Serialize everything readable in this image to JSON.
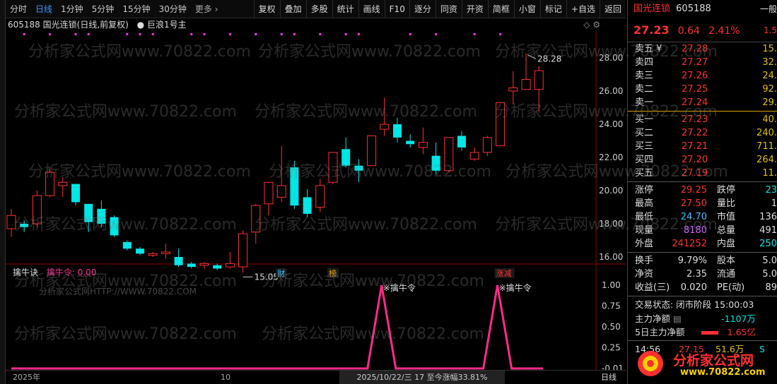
{
  "toolbar": {
    "periods": [
      "分时",
      "日线",
      "1分钟",
      "5分钟",
      "15分钟",
      "30分钟",
      "更多 ›"
    ],
    "active_period_index": 1,
    "tools": [
      "复权",
      "叠加",
      "多股",
      "统计",
      "画线",
      "F10",
      "逐分",
      "同资",
      "开资",
      "简框",
      "小窗",
      "标记",
      "+自选",
      "返回"
    ]
  },
  "chart": {
    "header_code": "605188",
    "header_name": "国光连锁",
    "header_mode": "(日线,前复权)",
    "indicator_name": "巨浪1号主",
    "y_labels": [
      "28.00",
      "26.00",
      "24.00",
      "22.00",
      "20.00",
      "18.00",
      "16.00"
    ],
    "max_label": "28.28",
    "min_label": "15.05",
    "event_marks": [
      "财",
      "榜",
      "涨减"
    ],
    "up_color": "#ff3030",
    "down_color": "#00e5e5",
    "candles": [
      [
        17.7,
        18.5,
        17.2,
        18.9
      ],
      [
        18.0,
        17.8,
        17.5,
        18.2
      ],
      [
        18.0,
        19.7,
        17.8,
        20.0
      ],
      [
        19.7,
        21.1,
        19.6,
        21.4
      ],
      [
        20.3,
        20.5,
        19.6,
        20.8
      ],
      [
        20.4,
        19.3,
        19.1,
        20.4
      ],
      [
        19.2,
        18.1,
        17.5,
        19.2
      ],
      [
        18.9,
        18.0,
        17.8,
        19.4
      ],
      [
        18.4,
        17.3,
        17.2,
        18.5
      ],
      [
        16.9,
        16.5,
        16.4,
        17.0
      ],
      [
        16.5,
        16.2,
        16.1,
        16.6
      ],
      [
        16.1,
        16.2,
        16.0,
        16.3
      ],
      [
        16.2,
        16.3,
        15.9,
        16.8
      ],
      [
        16.0,
        15.5,
        15.4,
        16.5
      ],
      [
        15.6,
        15.4,
        15.3,
        15.7
      ],
      [
        15.5,
        15.6,
        15.3,
        15.7
      ],
      [
        15.5,
        15.3,
        15.2,
        15.6
      ],
      [
        15.4,
        15.6,
        15.3,
        16.3
      ],
      [
        15.4,
        17.4,
        15.05,
        17.6
      ],
      [
        17.5,
        19.1,
        16.8,
        19.2
      ],
      [
        19.2,
        20.5,
        18.5,
        20.5
      ],
      [
        19.6,
        20.3,
        19.3,
        22.7
      ],
      [
        21.4,
        19.1,
        18.9,
        21.8
      ],
      [
        19.6,
        18.6,
        18.4,
        20.1
      ],
      [
        19.0,
        20.3,
        18.7,
        20.7
      ],
      [
        20.5,
        22.3,
        20.4,
        22.3
      ],
      [
        22.5,
        21.5,
        21.4,
        23.2
      ],
      [
        21.5,
        21.2,
        20.5,
        21.9
      ],
      [
        21.5,
        23.3,
        21.5,
        23.3
      ],
      [
        23.7,
        24.0,
        23.3,
        25.6
      ],
      [
        24.0,
        23.2,
        22.9,
        24.4
      ],
      [
        23.0,
        22.8,
        22.6,
        23.4
      ],
      [
        22.6,
        22.9,
        22.2,
        23.8
      ],
      [
        22.1,
        21.2,
        21.0,
        22.9
      ],
      [
        21.2,
        23.2,
        21.1,
        23.2
      ],
      [
        23.3,
        22.6,
        22.4,
        23.6
      ],
      [
        21.9,
        22.3,
        21.8,
        22.6
      ],
      [
        22.3,
        23.2,
        22.1,
        23.3
      ],
      [
        22.7,
        25.3,
        22.7,
        25.3
      ],
      [
        26.0,
        26.2,
        25.2,
        27.2
      ],
      [
        26.1,
        26.7,
        26.1,
        28.28
      ],
      [
        26.1,
        27.23,
        24.7,
        27.5
      ]
    ],
    "marker_dot_color": "#ff33ff"
  },
  "sub": {
    "name": "擒牛诀",
    "value_label": "擒牛令: 0.00",
    "watermark_line": "分析家公式网HTTP://WWW.70822.COM",
    "y_labels": [
      "1.00",
      "0.75",
      "0.50",
      "0.25",
      "-0.01"
    ],
    "signal_label": "※擒牛令",
    "line_color": "#ff2a8a"
  },
  "footer": {
    "year": "2025年",
    "month": "10",
    "range": "2025/10/22/三  17  至今涨幅33.81%",
    "period": "日线"
  },
  "panel": {
    "name": "国光连锁",
    "code": "605188",
    "tag": "一般",
    "price": "27.23",
    "change": "0.64",
    "pct": "2.41%",
    "tag2": "1.5",
    "asks": [
      {
        "label": "卖五 ¥",
        "price": "27.28",
        "vol": "15."
      },
      {
        "label": "卖四",
        "price": "27.27",
        "vol": "32."
      },
      {
        "label": "卖三",
        "price": "27.26",
        "vol": "24."
      },
      {
        "label": "卖二",
        "price": "27.25",
        "vol": "92."
      },
      {
        "label": "卖一",
        "price": "27.24",
        "vol": "29."
      }
    ],
    "bids": [
      {
        "label": "买一",
        "price": "27.23",
        "vol": "40."
      },
      {
        "label": "买二",
        "price": "27.22",
        "vol": "240."
      },
      {
        "label": "买三",
        "price": "27.21",
        "vol": "711."
      },
      {
        "label": "买四",
        "price": "27.20",
        "vol": "264."
      },
      {
        "label": "买五",
        "price": "27.19",
        "vol": "11."
      }
    ],
    "quote1": [
      {
        "l1": "涨停",
        "v1": "29.25",
        "c1": "#ff3030",
        "l2": "跌停",
        "v2": "23",
        "c2": "#00e5e5"
      },
      {
        "l1": "最高",
        "v1": "27.50",
        "c1": "#ff3030",
        "l2": "量比",
        "v2": "1",
        "c2": "#ddd"
      },
      {
        "l1": "最低",
        "v1": "24.70",
        "c1": "#39c0ff",
        "l2": "市值",
        "v2": "136",
        "c2": "#ddd"
      },
      {
        "l1": "现量",
        "v1": "8180",
        "c1": "#cc66ff",
        "l2": "总量",
        "v2": "491",
        "c2": "#ddd"
      },
      {
        "l1": "外盘",
        "v1": "241252",
        "c1": "#ff3030",
        "l2": "内盘",
        "v2": "250",
        "c2": "#00e5e5"
      }
    ],
    "quote2": [
      {
        "l1": "换手",
        "v1": "9.79%",
        "c1": "#ddd",
        "l2": "股本",
        "v2": "5.0",
        "c2": "#ddd"
      },
      {
        "l1": "净资",
        "v1": "2.35",
        "c1": "#ddd",
        "l2": "流通",
        "v2": "5.0",
        "c2": "#ddd"
      },
      {
        "l1": "收益(三)",
        "v1": "0.020",
        "c1": "#ddd",
        "l2": "PE(动)",
        "v2": "89",
        "c2": "#ddd"
      }
    ],
    "status": "交易状态: 闭市阶段 15:00:03",
    "flow1_label": "主力净额",
    "flow1_value": "-1107万",
    "flow2_label": "5日主力净额",
    "flow2_value": "1.65亿",
    "tick_time": "14:56",
    "tick_price": "27.15",
    "tick_vol": "51.6万",
    "tick_side": "S",
    "logo_text": "分析家公式网",
    "logo_url": "www.70822.com"
  },
  "watermark": "分析家公式网www.70822.com"
}
